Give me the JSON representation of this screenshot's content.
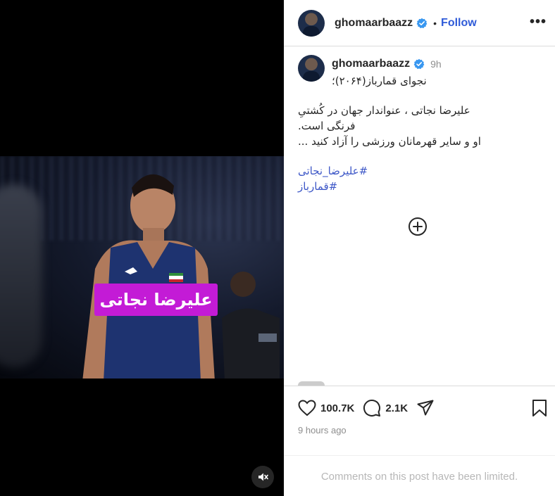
{
  "post": {
    "username": "ghomaarbaazz",
    "header_dot": "•",
    "follow_label": "Follow",
    "more_label": "•••",
    "time_ago_short": "9h",
    "caption_title": "نجوای قمارباز(۲۰۶۴)؛",
    "caption_para1": "علیرضا نجاتی ، عنواندار جهان در کُشتیِ فرنگی است.",
    "caption_para2": "او و سایر قهرمانان ورزشی را آزاد کنید ...",
    "hashtags": [
      "#علیرضا_نجاتی",
      "#قمارباز"
    ],
    "likes": "100.7K",
    "comments": "2.1K",
    "posted": "9 hours ago",
    "comments_limited": "Comments on this post have been limited."
  },
  "media": {
    "name_overlay": "علیرضا نجاتی",
    "overlay_color": "#c31bd6"
  },
  "icons": {
    "verified": "verified-badge-icon",
    "more": "more-options-icon",
    "plus": "plus-circle-icon",
    "like": "heart-icon",
    "comment": "comment-icon",
    "share": "share-icon",
    "save": "bookmark-icon",
    "mute": "speaker-muted-icon"
  },
  "colors": {
    "link": "#3d57c7",
    "follow": "#2f5bd8",
    "verified": "#3897f0"
  }
}
